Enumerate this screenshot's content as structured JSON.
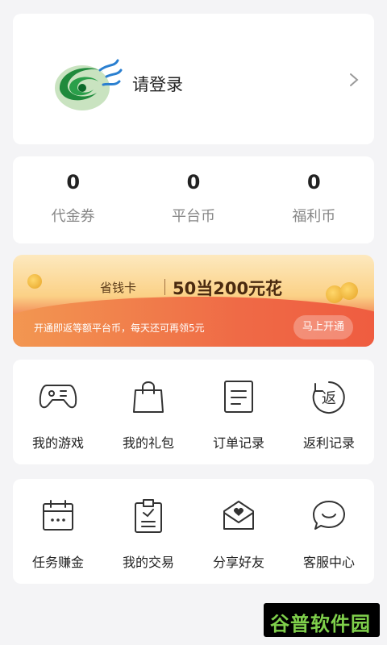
{
  "login": {
    "label": "请登录"
  },
  "stats": [
    {
      "value": "0",
      "label": "代金券"
    },
    {
      "value": "0",
      "label": "平台币"
    },
    {
      "value": "0",
      "label": "福利币"
    }
  ],
  "promo": {
    "card_name": "省钱卡",
    "headline": "50当200元花",
    "description": "开通即返等额平台币，每天还可再领5元",
    "button": "马上开通"
  },
  "grid1": [
    {
      "label": "我的游戏",
      "icon": "gamepad-icon"
    },
    {
      "label": "我的礼包",
      "icon": "gift-bag-icon"
    },
    {
      "label": "订单记录",
      "icon": "order-list-icon"
    },
    {
      "label": "返利记录",
      "icon": "rebate-icon"
    }
  ],
  "grid2": [
    {
      "label": "任务赚金",
      "icon": "calendar-icon"
    },
    {
      "label": "我的交易",
      "icon": "clipboard-icon"
    },
    {
      "label": "分享好友",
      "icon": "mail-heart-icon"
    },
    {
      "label": "客服中心",
      "icon": "chat-icon"
    }
  ],
  "icon_glyphs": {
    "rebate": "返"
  },
  "watermark": "谷普软件园"
}
